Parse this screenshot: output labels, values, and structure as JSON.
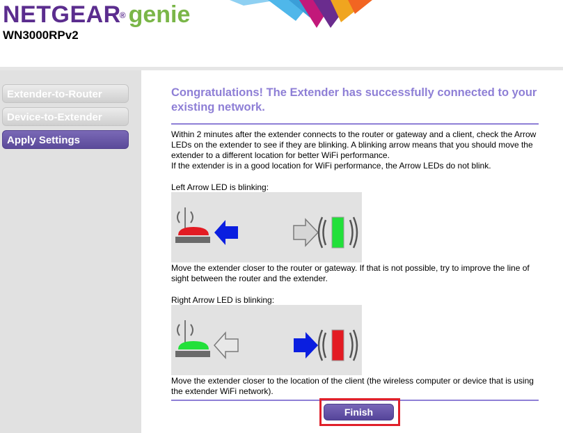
{
  "header": {
    "brand": "NETGEAR",
    "reg_mark": "®",
    "product": "genie",
    "model": "WN3000RPv2"
  },
  "sidebar": {
    "items": [
      {
        "label": "Extender-to-Router",
        "active": false
      },
      {
        "label": "Device-to-Extender",
        "active": false
      },
      {
        "label": "Apply Settings",
        "active": true
      }
    ]
  },
  "main": {
    "title": "Congratulations! The Extender has successfully connected to your existing network.",
    "intro": "Within 2 minutes after the extender connects to the router or gateway and a client, check the Arrow LEDs on the extender to see if they are blinking. A blinking arrow means that you should move the extender to a different location for better WiFi performance.\nIf the extender is in a good location for WiFi performance, the Arrow LEDs do not blink.",
    "left_label": "Left Arrow LED is blinking:",
    "left_desc": "Move the extender closer to the router or gateway. If that is not possible, try to improve the line of sight between the router and the extender.",
    "right_label": "Right Arrow LED is blinking:",
    "right_desc": "Move the extender closer to the location of the client (the wireless computer or device that is using the extender WiFi network).",
    "finish_label": "Finish"
  },
  "colors": {
    "brand_purple": "#5b2d8e",
    "genie_green": "#7ab648",
    "accent_lavender": "#8e7fd6",
    "button_purple": "#5b4a9a",
    "highlight_red": "#e0202a",
    "led_red": "#e31b23",
    "led_green": "#22e03a",
    "arrow_blue": "#0a1ee0"
  },
  "icons": {
    "left_diagram": [
      "router-red-icon",
      "arrow-left-blue-icon",
      "arrow-right-grey-icon",
      "extender-green-icon"
    ],
    "right_diagram": [
      "router-green-icon",
      "arrow-left-grey-icon",
      "arrow-right-blue-icon",
      "extender-red-icon"
    ]
  }
}
